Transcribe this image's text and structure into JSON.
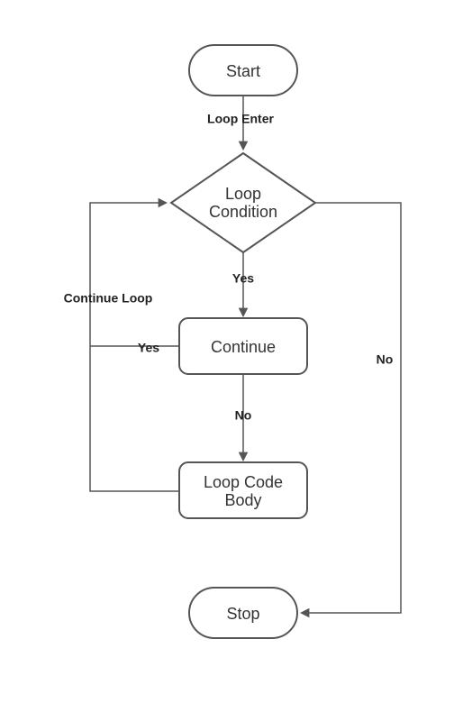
{
  "nodes": {
    "start": "Start",
    "condition_l1": "Loop",
    "condition_l2": "Condition",
    "continue": "Continue",
    "body_l1": "Loop Code",
    "body_l2": "Body",
    "stop": "Stop"
  },
  "edges": {
    "loop_enter": "Loop Enter",
    "cond_yes": "Yes",
    "cond_no": "No",
    "cont_yes": "Yes",
    "cont_no": "No",
    "continue_loop": "Continue Loop"
  }
}
